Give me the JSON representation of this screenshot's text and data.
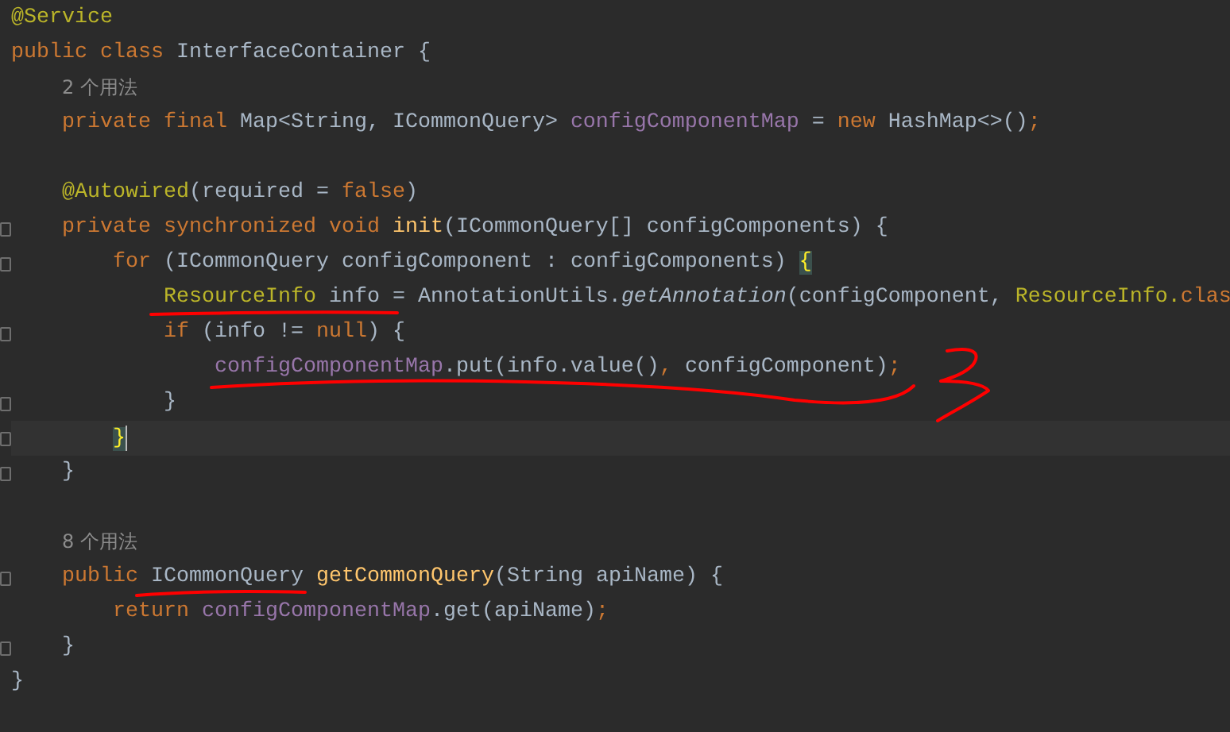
{
  "editor": {
    "lines": [
      {
        "current": false,
        "fold": false,
        "tokens": [
          {
            "kind": "annotation",
            "text": "@Service"
          }
        ]
      },
      {
        "current": false,
        "fold": false,
        "tokens": [
          {
            "kind": "keyword",
            "text": "public class "
          },
          {
            "kind": "plain",
            "text": "InterfaceContainer {"
          }
        ]
      },
      {
        "current": false,
        "fold": false,
        "tokens": [
          {
            "kind": "hint",
            "text": "    2 个用法"
          }
        ]
      },
      {
        "current": false,
        "fold": false,
        "tokens": [
          {
            "kind": "keyword",
            "text": "    private final "
          },
          {
            "kind": "plain",
            "text": "Map<String, ICommonQuery> "
          },
          {
            "kind": "field",
            "text": "configComponentMap"
          },
          {
            "kind": "plain",
            "text": " = "
          },
          {
            "kind": "keyword",
            "text": "new "
          },
          {
            "kind": "plain",
            "text": "HashMap<>()"
          },
          {
            "kind": "keyword",
            "text": ";"
          }
        ]
      },
      {
        "current": false,
        "fold": false
      },
      {
        "current": false,
        "fold": false,
        "tokens": [
          {
            "kind": "annotation",
            "text": "    @Autowired"
          },
          {
            "kind": "plain",
            "text": "(required = "
          },
          {
            "kind": "keyword",
            "text": "false"
          },
          {
            "kind": "plain",
            "text": ")"
          }
        ]
      },
      {
        "current": false,
        "fold": true,
        "tokens": [
          {
            "kind": "keyword",
            "text": "    private synchronized void "
          },
          {
            "kind": "method",
            "text": "init"
          },
          {
            "kind": "plain",
            "text": "(ICommonQuery[] configComponents) {"
          }
        ]
      },
      {
        "current": false,
        "fold": true,
        "tokens": [
          {
            "kind": "keyword",
            "text": "        for "
          },
          {
            "kind": "plain",
            "text": "(ICommonQuery configComponent : configComponents) "
          },
          {
            "kind": "brace",
            "text": "{"
          }
        ]
      },
      {
        "current": false,
        "fold": false,
        "tokens": [
          {
            "kind": "type",
            "text": "            ResourceInfo"
          },
          {
            "kind": "plain",
            "text": " info = AnnotationUtils."
          },
          {
            "kind": "static",
            "text": "getAnnotation"
          },
          {
            "kind": "plain",
            "text": "(configComponent, "
          },
          {
            "kind": "type",
            "text": "ResourceInfo."
          },
          {
            "kind": "keyword",
            "text": "clas"
          }
        ]
      },
      {
        "current": false,
        "fold": true,
        "tokens": [
          {
            "kind": "keyword",
            "text": "            if "
          },
          {
            "kind": "plain",
            "text": "(info != "
          },
          {
            "kind": "keyword",
            "text": "null"
          },
          {
            "kind": "plain",
            "text": ") {"
          }
        ]
      },
      {
        "current": false,
        "fold": false,
        "tokens": [
          {
            "kind": "field",
            "text": "                configComponentMap"
          },
          {
            "kind": "plain",
            "text": ".put(info.value()"
          },
          {
            "kind": "keyword",
            "text": ", "
          },
          {
            "kind": "plain",
            "text": "configComponent)"
          },
          {
            "kind": "keyword",
            "text": ";"
          }
        ]
      },
      {
        "current": false,
        "fold": true,
        "tokens": [
          {
            "kind": "plain",
            "text": "            }"
          }
        ]
      },
      {
        "current": true,
        "fold": true,
        "tokens": [
          {
            "kind": "brace",
            "text": "        }"
          }
        ]
      },
      {
        "current": false,
        "fold": true,
        "tokens": [
          {
            "kind": "plain",
            "text": "    }"
          }
        ]
      },
      {
        "current": false,
        "fold": false
      },
      {
        "current": false,
        "fold": false,
        "tokens": [
          {
            "kind": "hint",
            "text": "    8 个用法"
          }
        ]
      },
      {
        "current": false,
        "fold": true,
        "tokens": [
          {
            "kind": "keyword",
            "text": "    public "
          },
          {
            "kind": "plain",
            "text": "ICommonQuery "
          },
          {
            "kind": "method",
            "text": "getCommonQuery"
          },
          {
            "kind": "plain",
            "text": "(String apiName) {"
          }
        ]
      },
      {
        "current": false,
        "fold": false,
        "tokens": [
          {
            "kind": "keyword",
            "text": "        return "
          },
          {
            "kind": "field",
            "text": "configComponentMap"
          },
          {
            "kind": "plain",
            "text": ".get(apiName)"
          },
          {
            "kind": "keyword",
            "text": ";"
          }
        ]
      },
      {
        "current": false,
        "fold": true,
        "tokens": [
          {
            "kind": "plain",
            "text": "    }"
          }
        ]
      },
      {
        "current": false,
        "fold": false,
        "tokens": [
          {
            "kind": "plain",
            "text": "}"
          }
        ]
      }
    ]
  }
}
